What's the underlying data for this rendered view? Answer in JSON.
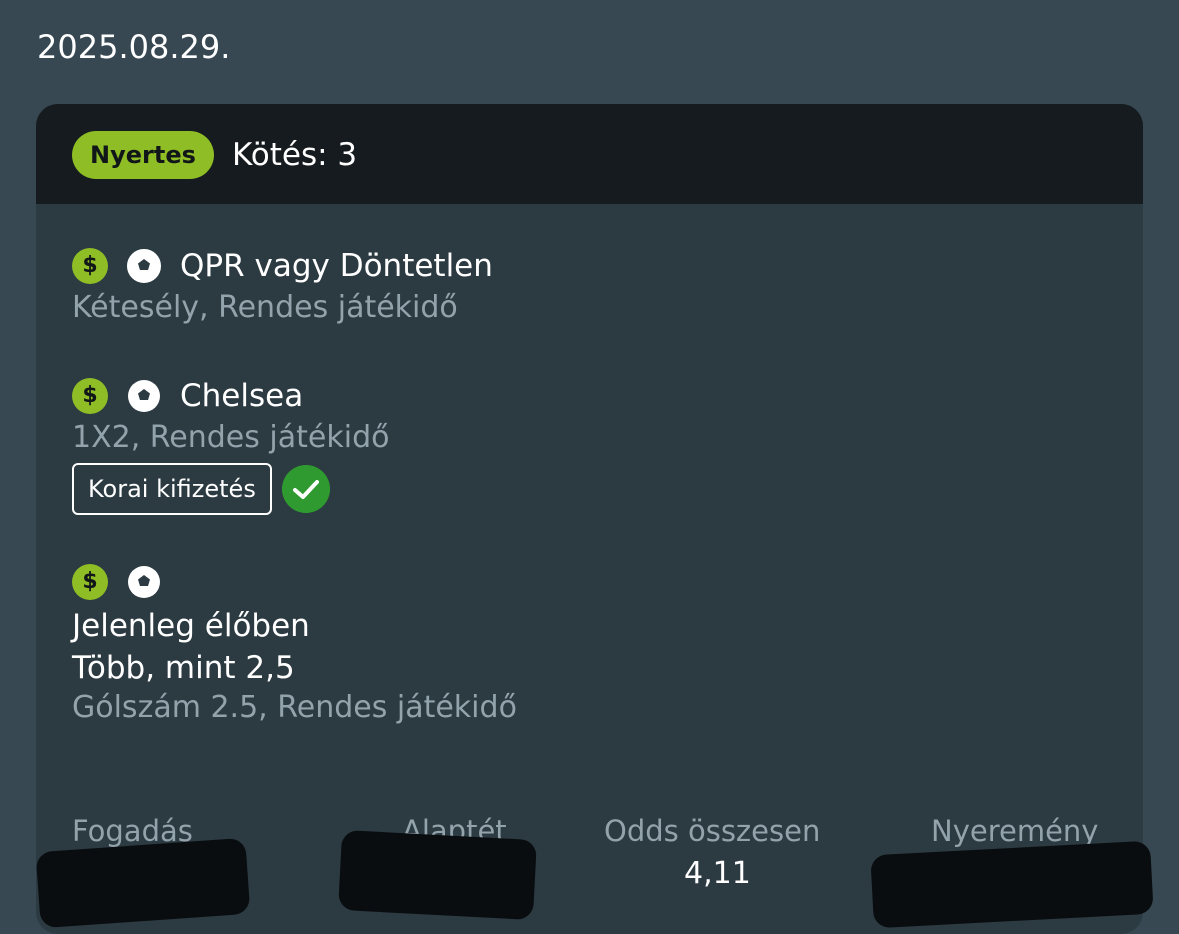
{
  "date": "2025.08.29.",
  "card": {
    "status": "Nyertes",
    "bet_count": "Kötés: 3",
    "selections": [
      {
        "name": "QPR vagy Döntetlen",
        "market": "Kétesély, Rendes játékidő"
      },
      {
        "name": "Chelsea",
        "market": "1X2, Rendes játékidő",
        "tag": "Korai kifizetés"
      },
      {
        "live": "Jelenleg élőben",
        "line": "Több, mint 2,5",
        "market": "Gólszám 2.5, Rendes játékidő"
      }
    ],
    "footer": {
      "labels": [
        "Fogadás",
        "Alaptét",
        "Odds összesen",
        "Nyeremény"
      ],
      "odds_value": "4,11"
    }
  },
  "icons": {
    "dollar": "dollar-icon",
    "ball": "soccer-ball-icon",
    "check": "check-icon"
  },
  "colors": {
    "accent": "#8fbd25",
    "success": "#2f9a2f",
    "background": "#374852",
    "card": "#2c3a42",
    "header": "#151b1f"
  }
}
